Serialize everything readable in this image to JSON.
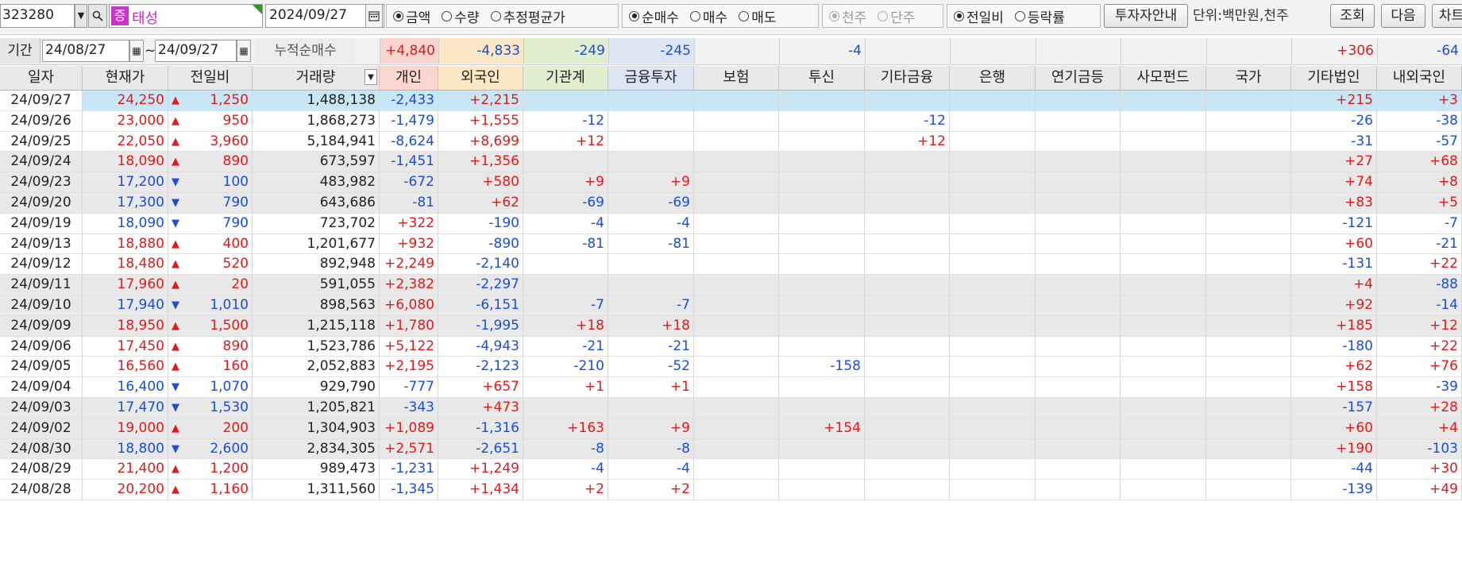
{
  "toolbar": {
    "code": "323280",
    "dropdown_arrow": "▼",
    "search_icon": "magnifier",
    "badge": "증",
    "stock_name": "태성",
    "date": "2024/09/27",
    "calendar_icon": "calendar",
    "value_type": [
      {
        "label": "금액",
        "checked": true
      },
      {
        "label": "수량",
        "checked": false
      },
      {
        "label": "추정평균가",
        "checked": false
      }
    ],
    "trade_type": [
      {
        "label": "순매수",
        "checked": true
      },
      {
        "label": "매수",
        "checked": false
      },
      {
        "label": "매도",
        "checked": false
      }
    ],
    "share_unit": [
      {
        "label": "천주",
        "checked": true
      },
      {
        "label": "단주",
        "checked": false
      }
    ],
    "compare_type": [
      {
        "label": "전일비",
        "checked": true
      },
      {
        "label": "등락률",
        "checked": false
      }
    ],
    "investor_guide_button": "투자자안내",
    "unit_text": "단위:백만원,천주",
    "query_button": "조회",
    "next_button": "다음",
    "chart_button": "차트"
  },
  "period": {
    "label": "기간",
    "from": "24/08/27",
    "tilde": "~",
    "to": "24/09/27",
    "cumulative_label": "누적순매수",
    "sums": [
      "+4,840",
      "-4,833",
      "-249",
      "-245",
      "",
      "-4",
      "",
      "",
      "",
      "",
      "",
      "+306",
      "-64"
    ]
  },
  "columns": [
    "일자",
    "현재가",
    "전일비",
    "거래량",
    "개인",
    "외국인",
    "기관계",
    "금융투자",
    "보험",
    "투신",
    "기타금융",
    "은행",
    "연기금등",
    "사모펀드",
    "국가",
    "기타법인",
    "내외국인"
  ],
  "sort_icon": "▼",
  "rows": [
    {
      "date": "24/09/27",
      "price": "24,250",
      "dir": "up",
      "arrow": "▲",
      "change": "1,250",
      "volume": "1,488,138",
      "v": [
        "-2,433",
        "+2,215",
        "",
        "",
        "",
        "",
        "",
        "",
        "",
        "",
        "",
        "+215",
        "+3"
      ]
    },
    {
      "date": "24/09/26",
      "price": "23,000",
      "dir": "up",
      "arrow": "▲",
      "change": "950",
      "volume": "1,868,273",
      "v": [
        "-1,479",
        "+1,555",
        "-12",
        "",
        "",
        "",
        "-12",
        "",
        "",
        "",
        "",
        "-26",
        "-38"
      ]
    },
    {
      "date": "24/09/25",
      "price": "22,050",
      "dir": "up",
      "arrow": "▲",
      "change": "3,960",
      "volume": "5,184,941",
      "v": [
        "-8,624",
        "+8,699",
        "+12",
        "",
        "",
        "",
        "+12",
        "",
        "",
        "",
        "",
        "-31",
        "-57"
      ]
    },
    {
      "date": "24/09/24",
      "price": "18,090",
      "dir": "up",
      "arrow": "▲",
      "change": "890",
      "volume": "673,597",
      "v": [
        "-1,451",
        "+1,356",
        "",
        "",
        "",
        "",
        "",
        "",
        "",
        "",
        "",
        "+27",
        "+68"
      ]
    },
    {
      "date": "24/09/23",
      "price": "17,200",
      "dir": "down",
      "arrow": "▼",
      "change": "100",
      "volume": "483,982",
      "v": [
        "-672",
        "+580",
        "+9",
        "+9",
        "",
        "",
        "",
        "",
        "",
        "",
        "",
        "+74",
        "+8"
      ]
    },
    {
      "date": "24/09/20",
      "price": "17,300",
      "dir": "down",
      "arrow": "▼",
      "change": "790",
      "volume": "643,686",
      "v": [
        "-81",
        "+62",
        "-69",
        "-69",
        "",
        "",
        "",
        "",
        "",
        "",
        "",
        "+83",
        "+5"
      ]
    },
    {
      "date": "24/09/19",
      "price": "18,090",
      "dir": "down",
      "arrow": "▼",
      "change": "790",
      "volume": "723,702",
      "v": [
        "+322",
        "-190",
        "-4",
        "-4",
        "",
        "",
        "",
        "",
        "",
        "",
        "",
        "-121",
        "-7"
      ]
    },
    {
      "date": "24/09/13",
      "price": "18,880",
      "dir": "up",
      "arrow": "▲",
      "change": "400",
      "volume": "1,201,677",
      "v": [
        "+932",
        "-890",
        "-81",
        "-81",
        "",
        "",
        "",
        "",
        "",
        "",
        "",
        "+60",
        "-21"
      ]
    },
    {
      "date": "24/09/12",
      "price": "18,480",
      "dir": "up",
      "arrow": "▲",
      "change": "520",
      "volume": "892,948",
      "v": [
        "+2,249",
        "-2,140",
        "",
        "",
        "",
        "",
        "",
        "",
        "",
        "",
        "",
        "-131",
        "+22"
      ]
    },
    {
      "date": "24/09/11",
      "price": "17,960",
      "dir": "up",
      "arrow": "▲",
      "change": "20",
      "volume": "591,055",
      "v": [
        "+2,382",
        "-2,297",
        "",
        "",
        "",
        "",
        "",
        "",
        "",
        "",
        "",
        "+4",
        "-88"
      ]
    },
    {
      "date": "24/09/10",
      "price": "17,940",
      "dir": "down",
      "arrow": "▼",
      "change": "1,010",
      "volume": "898,563",
      "v": [
        "+6,080",
        "-6,151",
        "-7",
        "-7",
        "",
        "",
        "",
        "",
        "",
        "",
        "",
        "+92",
        "-14"
      ]
    },
    {
      "date": "24/09/09",
      "price": "18,950",
      "dir": "up",
      "arrow": "▲",
      "change": "1,500",
      "volume": "1,215,118",
      "v": [
        "+1,780",
        "-1,995",
        "+18",
        "+18",
        "",
        "",
        "",
        "",
        "",
        "",
        "",
        "+185",
        "+12"
      ]
    },
    {
      "date": "24/09/06",
      "price": "17,450",
      "dir": "up",
      "arrow": "▲",
      "change": "890",
      "volume": "1,523,786",
      "v": [
        "+5,122",
        "-4,943",
        "-21",
        "-21",
        "",
        "",
        "",
        "",
        "",
        "",
        "",
        "-180",
        "+22"
      ]
    },
    {
      "date": "24/09/05",
      "price": "16,560",
      "dir": "up",
      "arrow": "▲",
      "change": "160",
      "volume": "2,052,883",
      "v": [
        "+2,195",
        "-2,123",
        "-210",
        "-52",
        "",
        "-158",
        "",
        "",
        "",
        "",
        "",
        "+62",
        "+76"
      ]
    },
    {
      "date": "24/09/04",
      "price": "16,400",
      "dir": "down",
      "arrow": "▼",
      "change": "1,070",
      "volume": "929,790",
      "v": [
        "-777",
        "+657",
        "+1",
        "+1",
        "",
        "",
        "",
        "",
        "",
        "",
        "",
        "+158",
        "-39"
      ]
    },
    {
      "date": "24/09/03",
      "price": "17,470",
      "dir": "down",
      "arrow": "▼",
      "change": "1,530",
      "volume": "1,205,821",
      "v": [
        "-343",
        "+473",
        "",
        "",
        "",
        "",
        "",
        "",
        "",
        "",
        "",
        "-157",
        "+28"
      ]
    },
    {
      "date": "24/09/02",
      "price": "19,000",
      "dir": "up",
      "arrow": "▲",
      "change": "200",
      "volume": "1,304,903",
      "v": [
        "+1,089",
        "-1,316",
        "+163",
        "+9",
        "",
        "+154",
        "",
        "",
        "",
        "",
        "",
        "+60",
        "+4"
      ]
    },
    {
      "date": "24/08/30",
      "price": "18,800",
      "dir": "down",
      "arrow": "▼",
      "change": "2,600",
      "volume": "2,834,305",
      "v": [
        "+2,571",
        "-2,651",
        "-8",
        "-8",
        "",
        "",
        "",
        "",
        "",
        "",
        "",
        "+190",
        "-103"
      ]
    },
    {
      "date": "24/08/29",
      "price": "21,400",
      "dir": "up",
      "arrow": "▲",
      "change": "1,200",
      "volume": "989,473",
      "v": [
        "-1,231",
        "+1,249",
        "-4",
        "-4",
        "",
        "",
        "",
        "",
        "",
        "",
        "",
        "-44",
        "+30"
      ]
    },
    {
      "date": "24/08/28",
      "price": "20,200",
      "dir": "up",
      "arrow": "▲",
      "change": "1,160",
      "volume": "1,311,560",
      "v": [
        "-1,345",
        "+1,434",
        "+2",
        "+2",
        "",
        "",
        "",
        "",
        "",
        "",
        "",
        "-139",
        "+49"
      ]
    }
  ],
  "colors": {
    "up": "#e21a1a",
    "down": "#1a4ed8",
    "selected_row": "#c9e6f5",
    "gray_band": "#e8e8e8",
    "header_individual": "#fbd6d0",
    "header_foreign": "#fbe7c6",
    "header_institution": "#e2efcf",
    "header_finance": "#dde5f3"
  }
}
